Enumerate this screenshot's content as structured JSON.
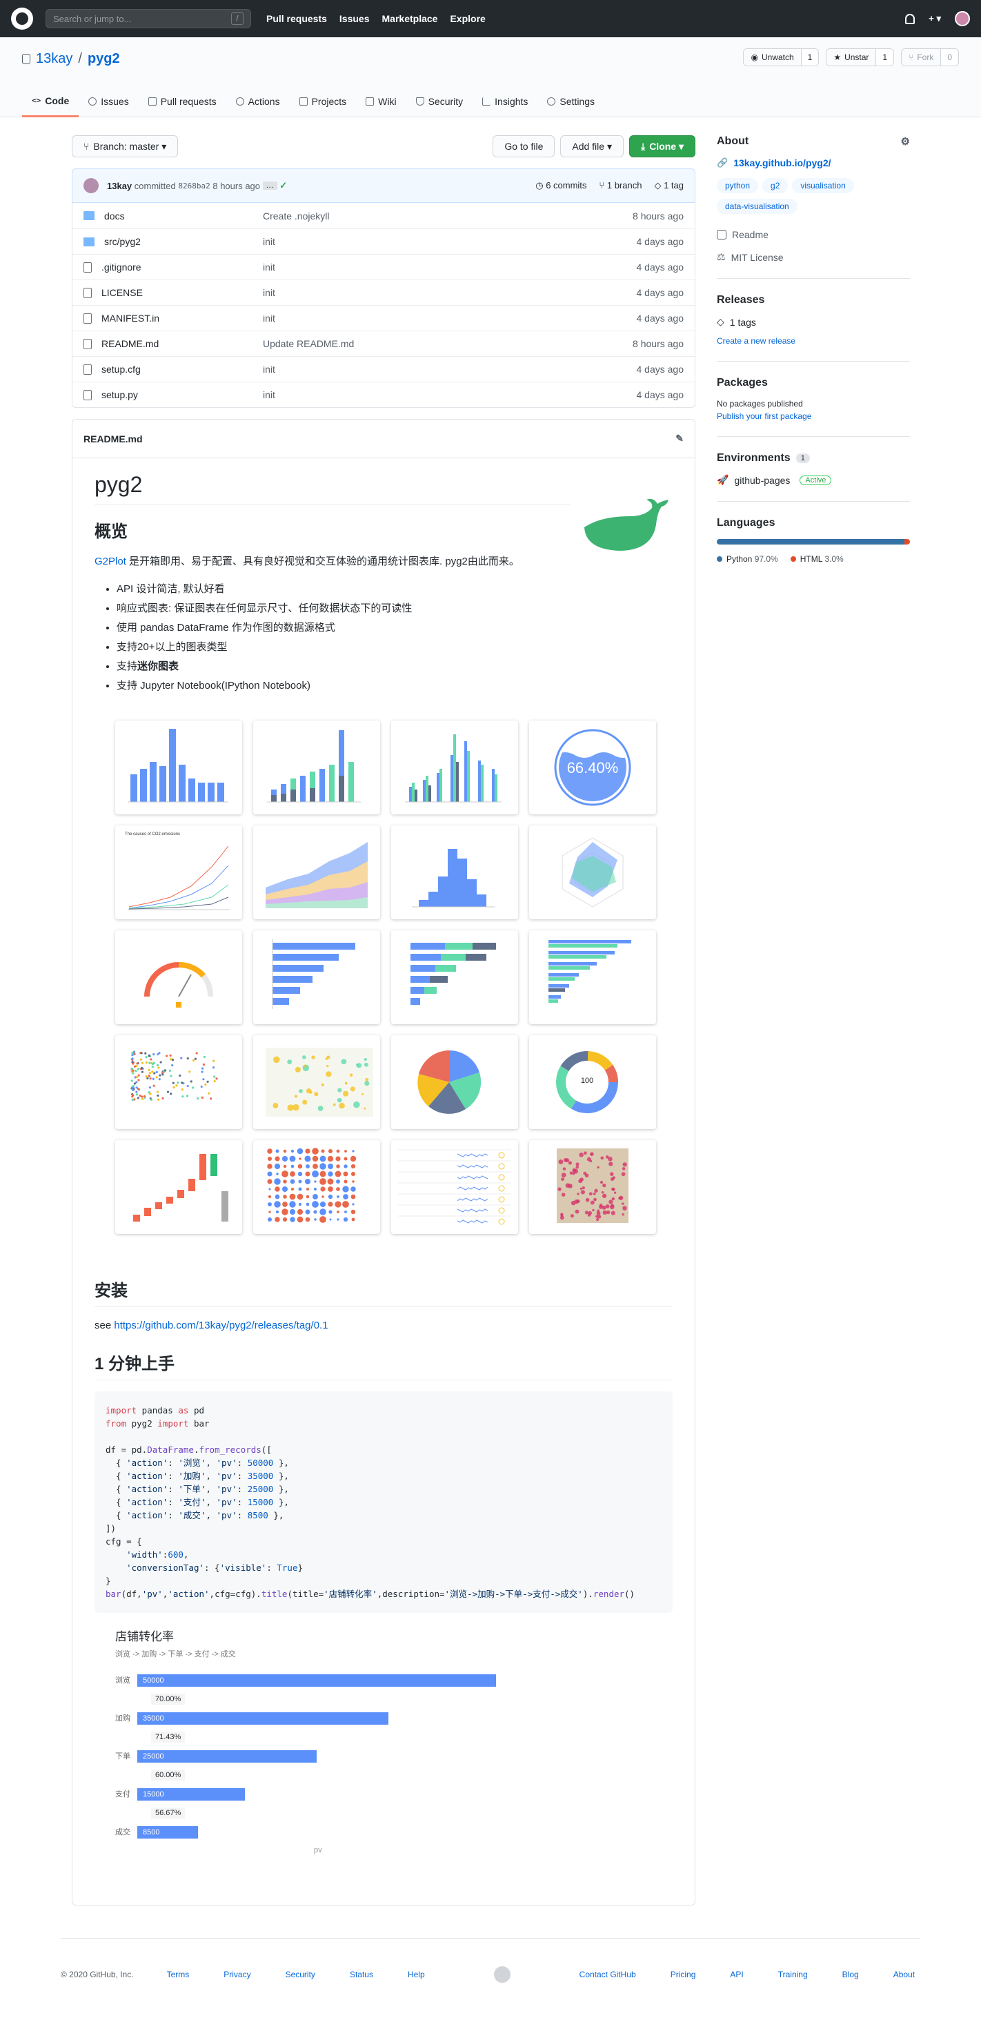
{
  "header": {
    "search_placeholder": "Search or jump to...",
    "search_key": "/",
    "nav": [
      "Pull requests",
      "Issues",
      "Marketplace",
      "Explore"
    ],
    "plus": "+ ▾"
  },
  "repo": {
    "owner": "13kay",
    "name": "pyg2",
    "watch": "Unwatch",
    "watch_count": "1",
    "star": "Unstar",
    "star_count": "1",
    "fork": "Fork",
    "fork_count": "0"
  },
  "tabs": [
    "Code",
    "Issues",
    "Pull requests",
    "Actions",
    "Projects",
    "Wiki",
    "Security",
    "Insights",
    "Settings"
  ],
  "toolbar": {
    "branch": "Branch: master ▾",
    "goto": "Go to file",
    "add": "Add file ▾",
    "clone": "Clone ▾"
  },
  "commit": {
    "author": "13kay",
    "text": "committed",
    "sha": "8268ba2",
    "time": "8 hours ago",
    "more": "…",
    "check": "✓",
    "commits": "6 commits",
    "branches": "1 branch",
    "tags": "1 tag"
  },
  "files": [
    {
      "name": "docs",
      "msg": "Create .nojekyll",
      "time": "8 hours ago",
      "type": "dir"
    },
    {
      "name": "src/pyg2",
      "msg": "init",
      "time": "4 days ago",
      "type": "dir"
    },
    {
      "name": ".gitignore",
      "msg": "init",
      "time": "4 days ago",
      "type": "file"
    },
    {
      "name": "LICENSE",
      "msg": "init",
      "time": "4 days ago",
      "type": "file"
    },
    {
      "name": "MANIFEST.in",
      "msg": "init",
      "time": "4 days ago",
      "type": "file"
    },
    {
      "name": "README.md",
      "msg": "Update README.md",
      "time": "8 hours ago",
      "type": "file"
    },
    {
      "name": "setup.cfg",
      "msg": "init",
      "time": "4 days ago",
      "type": "file"
    },
    {
      "name": "setup.py",
      "msg": "init",
      "time": "4 days ago",
      "type": "file"
    }
  ],
  "readme": {
    "file": "README.md",
    "title": "pyg2",
    "overview": "概览",
    "intro_link": "G2Plot",
    "intro": " 是开箱即用、易于配置、具有良好视觉和交互体验的通用统计图表库. pyg2由此而来。",
    "bullets": [
      "API 设计简洁, 默认好看",
      "响应式图表: 保证图表在任何显示尺寸、任何数据状态下的可读性",
      "使用 pandas DataFrame 作为作图的数据源格式",
      "支持20+以上的图表类型"
    ],
    "bullet_bold_pre": "支持",
    "bullet_bold": "迷你图表",
    "bullet_last": "支持 Jupyter Notebook(IPython Notebook)",
    "liquid": "66.40%",
    "donut": "100",
    "install": "安装",
    "see": "see ",
    "install_link": "https://github.com/13kay/pyg2/releases/tag/0.1",
    "quick": "1 分钟上手"
  },
  "funnel": {
    "title": "店铺转化率",
    "subtitle": "浏览 -> 加购 -> 下单 -> 支付 -> 成交",
    "xlabel": "pv",
    "rows": [
      {
        "label": "浏览",
        "value": "50000",
        "pct": "70.00%",
        "v": 50000
      },
      {
        "label": "加购",
        "value": "35000",
        "pct": "71.43%",
        "v": 35000
      },
      {
        "label": "下单",
        "value": "25000",
        "pct": "60.00%",
        "v": 25000
      },
      {
        "label": "支付",
        "value": "15000",
        "pct": "56.67%",
        "v": 15000
      },
      {
        "label": "成交",
        "value": "8500",
        "pct": "",
        "v": 8500
      }
    ]
  },
  "about": {
    "title": "About",
    "link": "13kay.github.io/pyg2/",
    "topics": [
      "python",
      "g2",
      "visualisation",
      "data-visualisation"
    ],
    "readme": "Readme",
    "license": "MIT License"
  },
  "releases": {
    "title": "Releases",
    "tags": "1 tags",
    "create": "Create a new release"
  },
  "packages": {
    "title": "Packages",
    "none": "No packages published",
    "publish": "Publish your first package"
  },
  "environments": {
    "title": "Environments",
    "count": "1",
    "name": "github-pages",
    "status": "Active"
  },
  "languages": {
    "title": "Languages",
    "items": [
      {
        "name": "Python",
        "pct": "97.0%",
        "v": 97,
        "color": "#3572A5"
      },
      {
        "name": "HTML",
        "pct": "3.0%",
        "v": 3,
        "color": "#e34c26"
      }
    ]
  },
  "footer": {
    "copy": "© 2020 GitHub, Inc.",
    "left": [
      "Terms",
      "Privacy",
      "Security",
      "Status",
      "Help"
    ],
    "right": [
      "Contact GitHub",
      "Pricing",
      "API",
      "Training",
      "Blog",
      "About"
    ]
  }
}
